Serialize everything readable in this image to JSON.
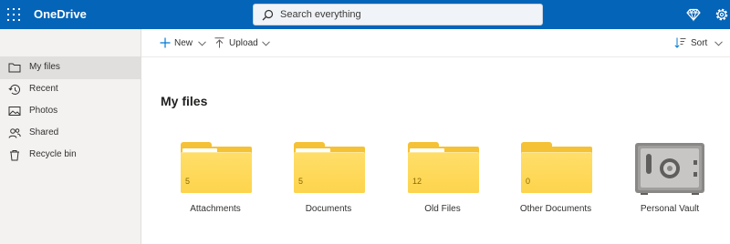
{
  "app": {
    "title": "OneDrive"
  },
  "search": {
    "placeholder": "Search everything",
    "icon": "search-icon"
  },
  "header": {
    "icons": [
      "diamond-icon",
      "gear-icon"
    ]
  },
  "sidebar": {
    "items": [
      {
        "label": "My files",
        "icon": "folder-icon",
        "active": true
      },
      {
        "label": "Recent",
        "icon": "history-icon"
      },
      {
        "label": "Photos",
        "icon": "image-icon"
      },
      {
        "label": "Shared",
        "icon": "people-icon"
      },
      {
        "label": "Recycle bin",
        "icon": "trash-icon"
      }
    ]
  },
  "commands": {
    "new_label": "New",
    "upload_label": "Upload",
    "sort_label": "Sort"
  },
  "main": {
    "title": "My files",
    "tiles": [
      {
        "name": "Attachments",
        "count": "5",
        "type": "folder"
      },
      {
        "name": "Documents",
        "count": "5",
        "type": "folder"
      },
      {
        "name": "Old Files",
        "count": "12",
        "type": "folder"
      },
      {
        "name": "Other Documents",
        "count": "0",
        "type": "folder"
      },
      {
        "name": "Personal Vault",
        "type": "vault"
      }
    ]
  },
  "colors": {
    "brand": "#0364b8",
    "folder": "#fdd44c",
    "sidebar_bg": "#f3f2f1",
    "accent": "#0078d4"
  }
}
